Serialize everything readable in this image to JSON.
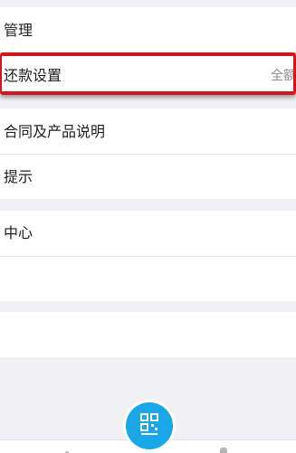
{
  "menu": {
    "row_management": {
      "label": "管理"
    },
    "row_repayment_settings": {
      "label": "还款设置",
      "value": "全额"
    },
    "row_contract": {
      "label": "合同及产品说明"
    },
    "row_tips": {
      "label": "提示"
    },
    "row_center": {
      "label": "中心"
    }
  },
  "tabbar": {
    "center_icon": "scan-icon"
  }
}
